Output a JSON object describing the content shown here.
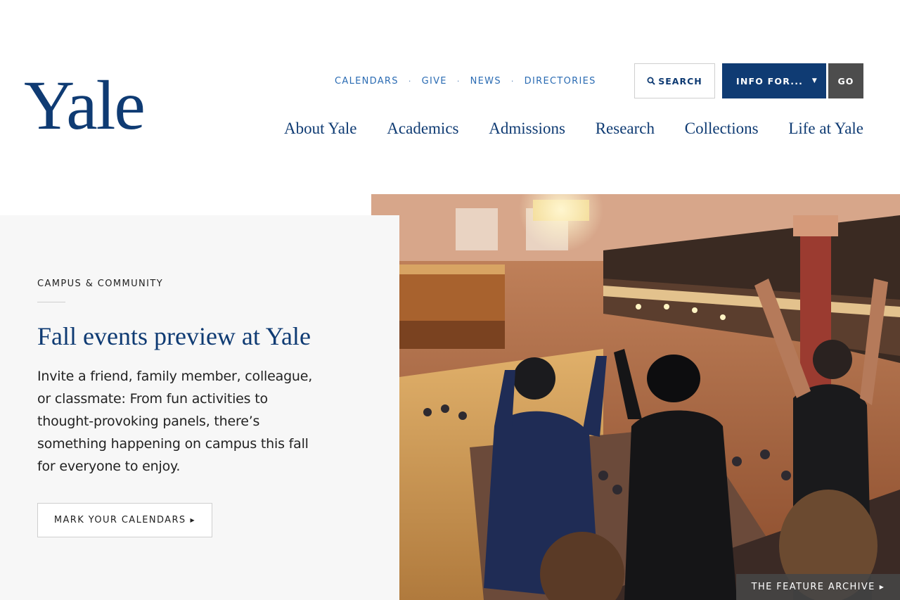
{
  "header": {
    "logo": "Yale",
    "utility_nav": [
      "CALENDARS",
      "GIVE",
      "NEWS",
      "DIRECTORIES"
    ],
    "search_label": "SEARCH",
    "info_for_label": "INFO FOR...",
    "go_label": "GO",
    "main_nav": [
      "About Yale",
      "Academics",
      "Admissions",
      "Research",
      "Collections",
      "Life at Yale"
    ]
  },
  "feature": {
    "eyebrow": "CAMPUS & COMMUNITY",
    "headline": "Fall events preview at Yale",
    "body": "Invite a friend, family member, colleague, or classmate: From fun activities to thought-provoking panels, there’s something happening on campus this fall for everyone to enjoy.",
    "cta_label": "MARK YOUR CALENDARS",
    "archive_label": "THE FEATURE ARCHIVE"
  },
  "colors": {
    "brand_blue": "#0f3b73",
    "link_blue": "#286dc0",
    "go_gray": "#4d4d4d",
    "panel_bg": "#f7f7f7"
  },
  "icons": [
    "search-icon",
    "caret-down-icon",
    "triangle-right-icon"
  ]
}
